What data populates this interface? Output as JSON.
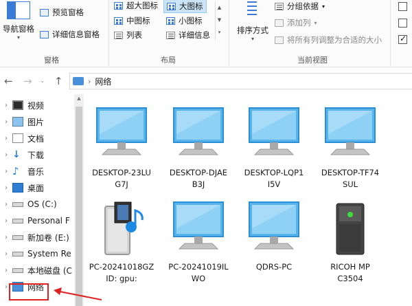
{
  "ribbon": {
    "pane_group": {
      "label": "窗格",
      "nav_pane": "导航窗格",
      "preview_pane": "预览窗格",
      "details_pane": "详细信息窗格"
    },
    "layout_group": {
      "label": "布局",
      "items": [
        "超大图标",
        "大图标",
        "中图标",
        "小图标",
        "列表",
        "详细信息"
      ],
      "selected": "大图标"
    },
    "current_view_group": {
      "label": "当前视图",
      "sort_by": "排序方式",
      "group_by": "分组依据",
      "add_column": "添加列",
      "size_all_columns": "将所有列调整为合适的大小"
    }
  },
  "addressbar": {
    "path": "网络"
  },
  "sidebar": {
    "items": [
      {
        "label": "视频",
        "icon": "video-folder-icon"
      },
      {
        "label": "图片",
        "icon": "pictures-folder-icon"
      },
      {
        "label": "文档",
        "icon": "documents-folder-icon"
      },
      {
        "label": "下载",
        "icon": "downloads-folder-icon"
      },
      {
        "label": "音乐",
        "icon": "music-folder-icon"
      },
      {
        "label": "桌面",
        "icon": "desktop-folder-icon"
      },
      {
        "label": "OS (C:)",
        "icon": "drive-icon"
      },
      {
        "label": "Personal F",
        "icon": "drive-icon"
      },
      {
        "label": "新加卷 (E:)",
        "icon": "drive-icon"
      },
      {
        "label": "System Re",
        "icon": "drive-icon"
      },
      {
        "label": "本地磁盘 (C",
        "icon": "drive-icon"
      },
      {
        "label": "网络",
        "icon": "network-icon"
      }
    ]
  },
  "content": {
    "tiles": [
      {
        "name": "DESKTOP-23LUG7J",
        "line1": "DESKTOP-23LU",
        "line2": "G7J",
        "icon": "computer-icon"
      },
      {
        "name": "DESKTOP-DJAEB3J",
        "line1": "DESKTOP-DJAE",
        "line2": "B3J",
        "icon": "computer-icon"
      },
      {
        "name": "DESKTOP-LQP1I5V",
        "line1": "DESKTOP-LQP1",
        "line2": "I5V",
        "icon": "computer-icon"
      },
      {
        "name": "DESKTOP-TF74SUL",
        "line1": "DESKTOP-TF74",
        "line2": "SUL",
        "icon": "computer-icon"
      },
      {
        "name": "PC-20241018GZ ID: gpu:",
        "line1": "PC-20241018GZ",
        "line2": "ID: gpu:",
        "icon": "media-server-icon"
      },
      {
        "name": "PC-20241019ILWO",
        "line1": "PC-20241019IL",
        "line2": "WO",
        "icon": "computer-icon"
      },
      {
        "name": "QDRS-PC",
        "line1": "QDRS-PC",
        "line2": "",
        "icon": "computer-icon"
      },
      {
        "name": "RICOH MP C3504",
        "line1": "RICOH MP",
        "line2": "C3504",
        "icon": "printer-device-icon"
      }
    ]
  },
  "colors": {
    "accent": "#3a7bd5",
    "selection": "#cce4f7",
    "annotation": "#e02020"
  }
}
